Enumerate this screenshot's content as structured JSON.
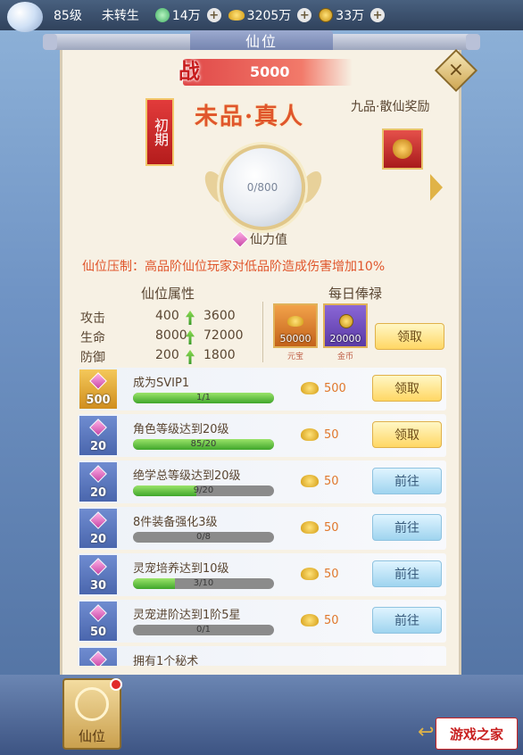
{
  "topbar": {
    "level": "85级",
    "rebirth": "未转生",
    "jade": "14万",
    "gold": "3205万",
    "coins": "33万",
    "plus_icon": "plus-icon"
  },
  "window": {
    "title": "仙位",
    "close_icon": "×"
  },
  "combat": {
    "badge": "战",
    "value": "5000"
  },
  "rank": {
    "stage": "初期",
    "title": "未品·真人",
    "reward_label": "九品·散仙奖励",
    "progress_text": "0/800",
    "progress_fraction": 0,
    "power_label": "仙力值"
  },
  "suppress_text": "仙位压制：高品阶仙位玩家对低品阶造成伤害增加10%",
  "attributes": {
    "header": "仙位属性",
    "rows": [
      {
        "name": "攻击",
        "current": "400",
        "next": "3600"
      },
      {
        "name": "生命",
        "current": "8000",
        "next": "72000"
      },
      {
        "name": "防御",
        "current": "200",
        "next": "1800"
      }
    ]
  },
  "daily": {
    "header": "每日俸禄",
    "items": [
      {
        "amount": "50000",
        "label": "元宝",
        "color": "#e58a2a"
      },
      {
        "amount": "20000",
        "label": "金币",
        "color": "#6a4ab8"
      }
    ],
    "claim_label": "领取"
  },
  "tasks": [
    {
      "badge": "500",
      "title": "成为SVIP1",
      "progress": "1/1",
      "fraction": 1.0,
      "reward": "500",
      "action": "领取",
      "kind": "claim",
      "gold": true
    },
    {
      "badge": "20",
      "title": "角色等级达到20级",
      "progress": "85/20",
      "fraction": 1.0,
      "reward": "50",
      "action": "领取",
      "kind": "claim",
      "gold": false
    },
    {
      "badge": "20",
      "title": "绝学总等级达到20级",
      "progress": "9/20",
      "fraction": 0.45,
      "reward": "50",
      "action": "前往",
      "kind": "go",
      "gold": false
    },
    {
      "badge": "20",
      "title": "8件装备强化3级",
      "progress": "0/8",
      "fraction": 0,
      "reward": "50",
      "action": "前往",
      "kind": "go",
      "gold": false
    },
    {
      "badge": "30",
      "title": "灵宠培养达到10级",
      "progress": "3/10",
      "fraction": 0.3,
      "reward": "50",
      "action": "前往",
      "kind": "go",
      "gold": false
    },
    {
      "badge": "50",
      "title": "灵宠进阶达到1阶5星",
      "progress": "0/1",
      "fraction": 0,
      "reward": "50",
      "action": "前往",
      "kind": "go",
      "gold": false
    },
    {
      "badge": "",
      "title": "拥有1个秘术",
      "progress": "",
      "fraction": 0,
      "reward": "",
      "action": "",
      "kind": "go",
      "gold": false
    }
  ],
  "bottom": {
    "xianwei_label": "仙位",
    "logo": "游戏之家"
  }
}
